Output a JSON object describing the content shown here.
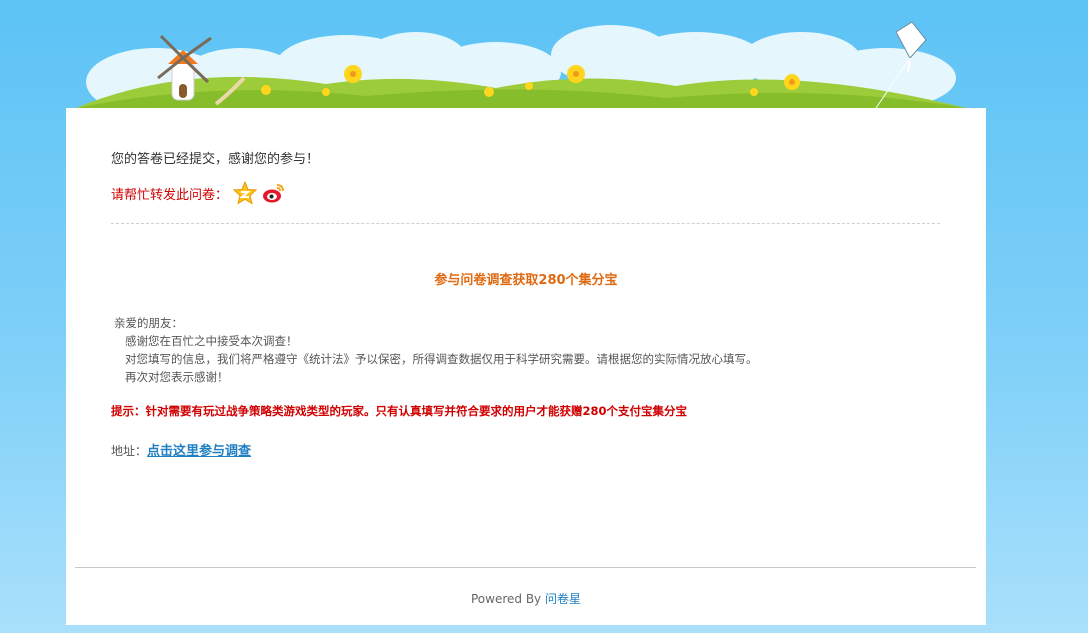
{
  "completion": {
    "message": "您的答卷已经提交，感谢您的参与！"
  },
  "share": {
    "label": "请帮忙转发此问卷：",
    "icons": [
      "qzone-star-icon",
      "weibo-icon"
    ]
  },
  "article": {
    "title": "参与问卷调查获取280个集分宝",
    "greeting": "亲爱的朋友：",
    "lines": [
      "感谢您在百忙之中接受本次调查！",
      "对您填写的信息，我们将严格遵守《统计法》予以保密，所得调查数据仅用于科学研究需要。请根据您的实际情况放心填写。",
      "再次对您表示感谢！"
    ],
    "tip": "提示：针对需要有玩过战争策略类游戏类型的玩家。只有认真填写并符合要求的用户才能获赠280个支付宝集分宝",
    "address_label": "地址：",
    "address_link": "点击这里参与调查"
  },
  "footer": {
    "powered_by": "Powered By",
    "brand": "问卷星"
  },
  "colors": {
    "sky": "#5cc3f5",
    "accent_orange": "#e06a12",
    "alert_red": "#d00000",
    "link_blue": "#1f7fc2"
  }
}
